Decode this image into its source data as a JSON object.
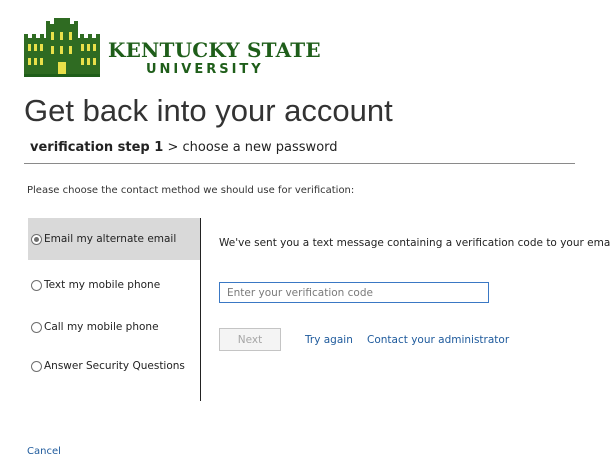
{
  "header": {
    "logo_line1": "KENTUCKY STATE",
    "logo_line2": "UNIVERSITY",
    "brand_color": "#1f5e1a"
  },
  "page_title": "Get back into your account",
  "steps": {
    "current": "verification step 1",
    "separator": ">",
    "next": "choose a new password"
  },
  "instruction": "Please choose the contact method we should use for verification:",
  "methods": [
    {
      "label": "Email my alternate email",
      "selected": true
    },
    {
      "label": "Text my mobile phone",
      "selected": false
    },
    {
      "label": "Call my mobile phone",
      "selected": false
    },
    {
      "label": "Answer Security Questions",
      "selected": false
    }
  ],
  "detail": {
    "message": "We've sent you a text message containing a verification code to your email.",
    "code_input": {
      "value": "",
      "placeholder": "Enter your verification code"
    },
    "next_label": "Next",
    "try_again_label": "Try again",
    "contact_admin_label": "Contact your administrator"
  },
  "cancel_label": "Cancel",
  "colors": {
    "link": "#1e5a9c",
    "input_border": "#3a78c4",
    "selected_bg": "#d9d9d9"
  }
}
